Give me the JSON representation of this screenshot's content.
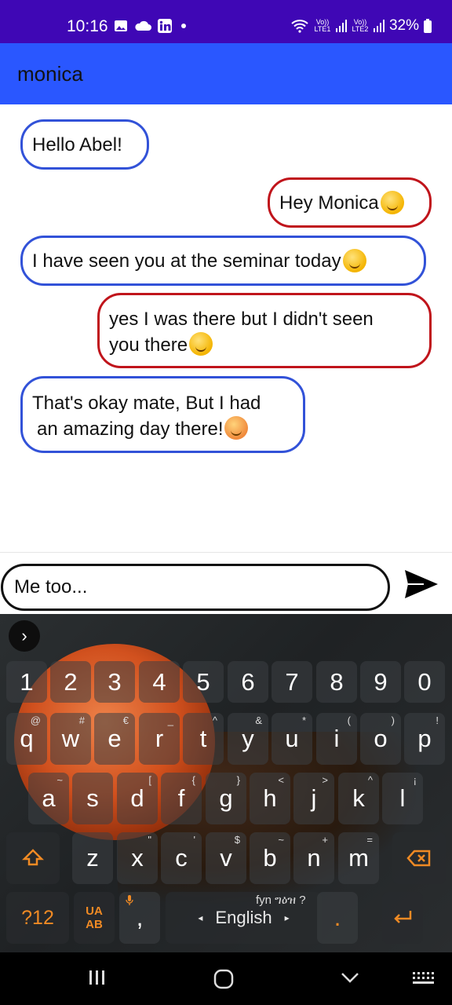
{
  "status_bar": {
    "time": "10:16",
    "network_labels": [
      "Vo)) LTE1",
      "Vo)) LTE2"
    ],
    "battery": "32%"
  },
  "app_bar": {
    "title": "monica"
  },
  "messages": [
    {
      "direction": "incoming",
      "line1": "Hello Abel!",
      "line2": ""
    },
    {
      "direction": "outgoing",
      "line1": "Hey Monica",
      "line2": ""
    },
    {
      "direction": "incoming",
      "line1": "I have seen you at the seminar today",
      "line2": ""
    },
    {
      "direction": "outgoing",
      "line1": "yes I was there but I didn't seen",
      "line2": "you there"
    },
    {
      "direction": "incoming",
      "line1": "That's okay mate, But I had",
      "line2": "an amazing day there!"
    }
  ],
  "composer": {
    "value": "Me too...",
    "send_icon": "send-icon"
  },
  "keyboard": {
    "numbers": [
      "1",
      "2",
      "3",
      "4",
      "5",
      "6",
      "7",
      "8",
      "9",
      "0"
    ],
    "row1": [
      "q",
      "w",
      "e",
      "r",
      "t",
      "y",
      "u",
      "i",
      "o",
      "p"
    ],
    "row1_hints": [
      "@",
      "#",
      "€",
      "_",
      "^",
      "&",
      "*",
      "(",
      ")",
      "!"
    ],
    "row2": [
      "a",
      "s",
      "d",
      "f",
      "g",
      "h",
      "j",
      "k",
      "l"
    ],
    "row2_hints": [
      "~",
      "",
      "[",
      "{",
      "}",
      "<",
      ">",
      "^",
      "¡"
    ],
    "row3": [
      "z",
      "x",
      "c",
      "v",
      "b",
      "n",
      "m"
    ],
    "row3_hints": [
      "",
      "\"",
      "'",
      "$",
      "~",
      "+",
      "="
    ],
    "symbols_key": "?12",
    "lang_switch": "UA AB",
    "comma": ",",
    "language": "English",
    "space_hint": "fyn ግዕዝ ?",
    "period": "."
  },
  "colors": {
    "status_bar": "#3f07b5",
    "app_bar": "#2a57ff",
    "incoming_border": "#3252d8",
    "outgoing_border": "#c0141b",
    "keyboard_accent": "#f08a24"
  }
}
